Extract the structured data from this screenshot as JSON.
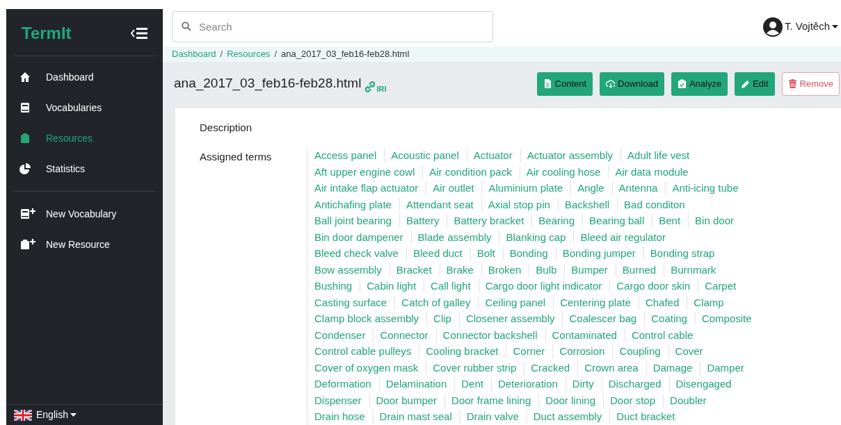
{
  "sidebar": {
    "logo": "TermIt",
    "items": [
      {
        "label": "Dashboard",
        "kind": "home",
        "selected": false
      },
      {
        "label": "Vocabularies",
        "kind": "book",
        "selected": false
      },
      {
        "label": "Resources",
        "kind": "clipboard",
        "selected": true
      },
      {
        "label": "Statistics",
        "kind": "pie",
        "selected": false
      }
    ],
    "actions": [
      {
        "label": "New Vocabulary",
        "kind": "book"
      },
      {
        "label": "New Resource",
        "kind": "clipboard"
      }
    ],
    "language": "English"
  },
  "search": {
    "placeholder": "Search"
  },
  "user": {
    "name": "T. Vojtěch"
  },
  "breadcrumb": [
    {
      "kind": "link",
      "label": "Dashboard"
    },
    {
      "kind": "separator",
      "label": "/"
    },
    {
      "kind": "link",
      "label": "Resources"
    },
    {
      "kind": "separator",
      "label": "/"
    },
    {
      "kind": "current",
      "label": "ana_2017_03_feb16-feb28.html"
    }
  ],
  "title": "ana_2017_03_feb16-feb28.html",
  "iri_label": "IRI",
  "buttons": [
    {
      "label": "Content",
      "kind": "content"
    },
    {
      "label": "Download",
      "kind": "download"
    },
    {
      "label": "Analyze",
      "kind": "analyze"
    },
    {
      "label": "Edit",
      "kind": "edit"
    },
    {
      "label": "Remove",
      "kind": "remove"
    }
  ],
  "details": {
    "description_label": "Description",
    "terms_label": "Assigned terms",
    "term_lines": [
      [
        "Access panel",
        "Acoustic panel",
        "Actuator",
        "Actuator assembly",
        "Adult life vest"
      ],
      [
        "Aft upper engine cowl",
        "Air condition pack",
        "Air cooling hose",
        "Air data module"
      ],
      [
        "Air intake flap actuator",
        "Air outlet",
        "Aluminium plate",
        "Angle",
        "Antenna",
        "Anti-icing tube"
      ],
      [
        "Antichafing plate",
        "Attendant seat",
        "Axial stop pin",
        "Backshell",
        "Bad conditon"
      ],
      [
        "Ball joint bearing",
        "Battery",
        "Battery bracket",
        "Bearing",
        "Bearing ball",
        "Bent",
        "Bin door"
      ],
      [
        "Bin door dampener",
        "Blade assembly",
        "Blanking cap",
        "Bleed air regulator"
      ],
      [
        "Bleed check valve",
        "Bleed duct",
        "Bolt",
        "Bonding",
        "Bonding jumper",
        "Bonding strap"
      ],
      [
        "Bow assembly",
        "Bracket",
        "Brake",
        "Broken",
        "Bulb",
        "Bumper",
        "Burned",
        "Burnmark"
      ],
      [
        "Bushing",
        "Cabin light",
        "Call light",
        "Cargo door light indicator",
        "Cargo door skin",
        "Carpet"
      ],
      [
        "Casting surface",
        "Catch of galley",
        "Ceiling panel",
        "Centering plate",
        "Chafed",
        "Clamp"
      ],
      [
        "Clamp block assembly",
        "Clip",
        "Closener assembly",
        "Coalescer bag",
        "Coating",
        "Composite"
      ],
      [
        "Condenser",
        "Connector",
        "Connector backshell",
        "Contaminated",
        "Control cable"
      ],
      [
        "Control cable pulleys",
        "Cooling bracket",
        "Corner",
        "Corrosion",
        "Coupling",
        "Cover"
      ],
      [
        "Cover of oxygen mask",
        "Cover rubber strip",
        "Cracked",
        "Crown area",
        "Damage",
        "Damper"
      ],
      [
        "Deformation",
        "Delamination",
        "Dent",
        "Deterioration",
        "Dirty",
        "Discharged",
        "Disengaged"
      ],
      [
        "Dispenser",
        "Door bumper",
        "Door frame lining",
        "Door lining",
        "Door stop",
        "Doubler"
      ],
      [
        "Drain hose",
        "Drain mast seal",
        "Drain valve",
        "Duct assembly",
        "Duct bracket"
      ]
    ]
  }
}
